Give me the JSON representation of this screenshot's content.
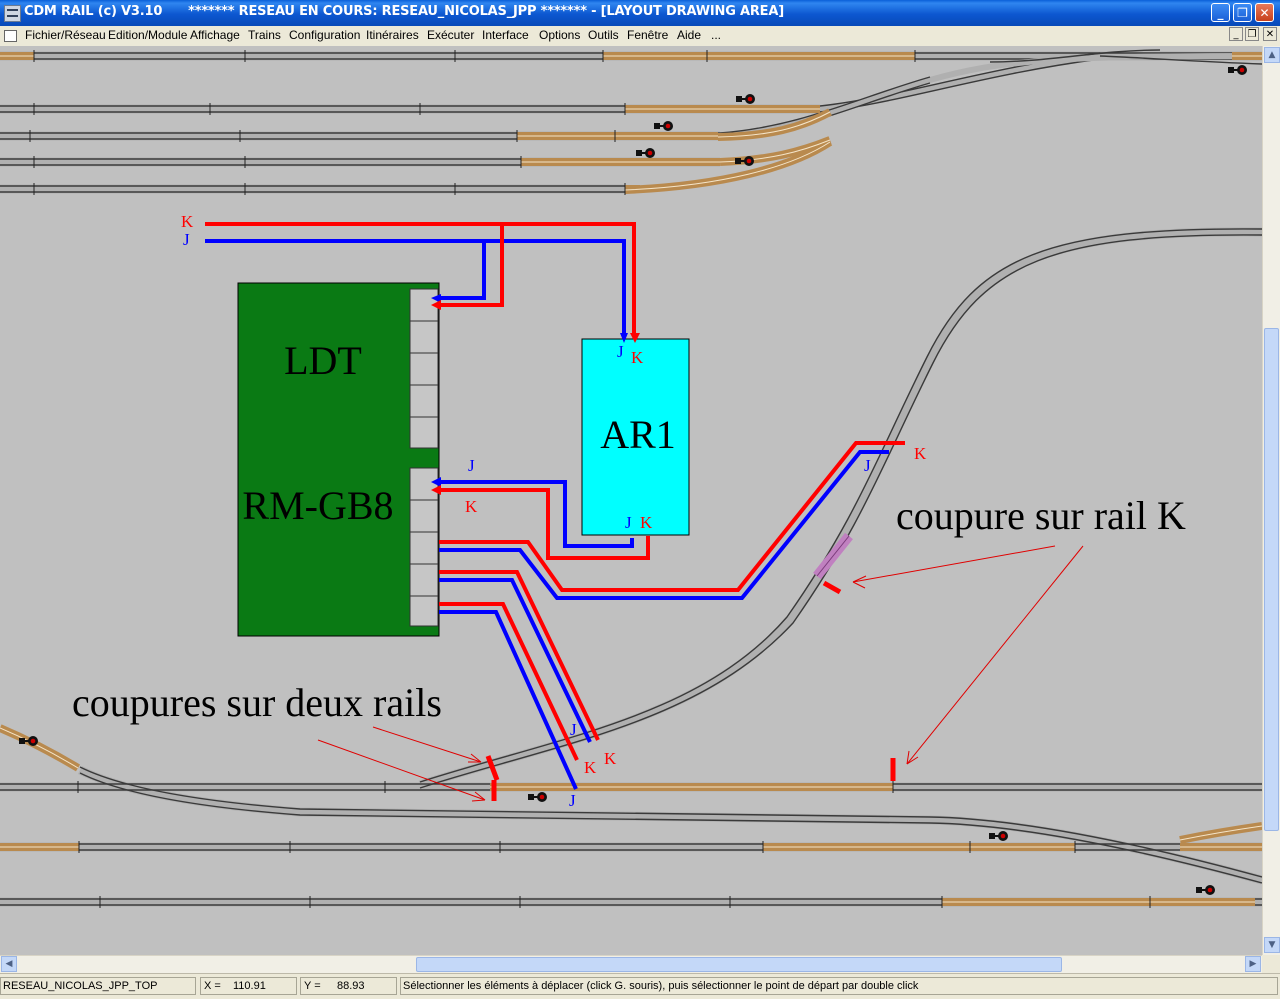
{
  "window": {
    "title": "CDM RAIL (c) V3.10      ******* RESEAU EN COURS: RESEAU_NICOLAS_JPP ******* - [LAYOUT DRAWING AREA]",
    "controls": [
      "_",
      "❐",
      "✕"
    ]
  },
  "menu": {
    "items": [
      "Fichier/Réseau",
      "Edition/Module",
      "Affichage",
      "Trains",
      "Configuration",
      "Itinéraires",
      "Exécuter",
      "Interface",
      "Options",
      "Outils",
      "Fenêtre",
      "Aide",
      "..."
    ],
    "mdi_controls": [
      "_",
      "❐",
      "✕"
    ]
  },
  "diagram": {
    "modules": {
      "ldt_label": "LDT",
      "rmgb8_label": "RM-GB8",
      "ar1_label": "AR1"
    },
    "wire_labels": {
      "k_top": "K",
      "j_top": "J",
      "ar1_j_top": "J",
      "ar1_k_top": "K",
      "ar1_j_bottom": "J",
      "ar1_k_bottom": "K",
      "rm_j": "J",
      "rm_k": "K",
      "upper_track_k": "K",
      "upper_track_j": "J",
      "low_j1": "J",
      "low_k1": "K",
      "low_k2": "K",
      "low_j2": "J"
    },
    "annotations": {
      "single_rail_cut": "coupure sur rail K",
      "double_rail_cut": "coupures sur deux rails"
    },
    "colors": {
      "wire_k": "#ff0000",
      "wire_j": "#0000ff",
      "module_green": "#0a7a14",
      "module_cyan": "#00ffff",
      "track_wood": "#c89a5a",
      "background": "#c0c0c0"
    }
  },
  "statusbar": {
    "network": "RESEAU_NICOLAS_JPP_TOP",
    "x_label": "X =",
    "x_value": "110.91",
    "y_label": "Y =",
    "y_value": "88.93",
    "hint": "Sélectionner les éléments à déplacer (click G. souris), puis sélectionner le point de départ par double click"
  }
}
